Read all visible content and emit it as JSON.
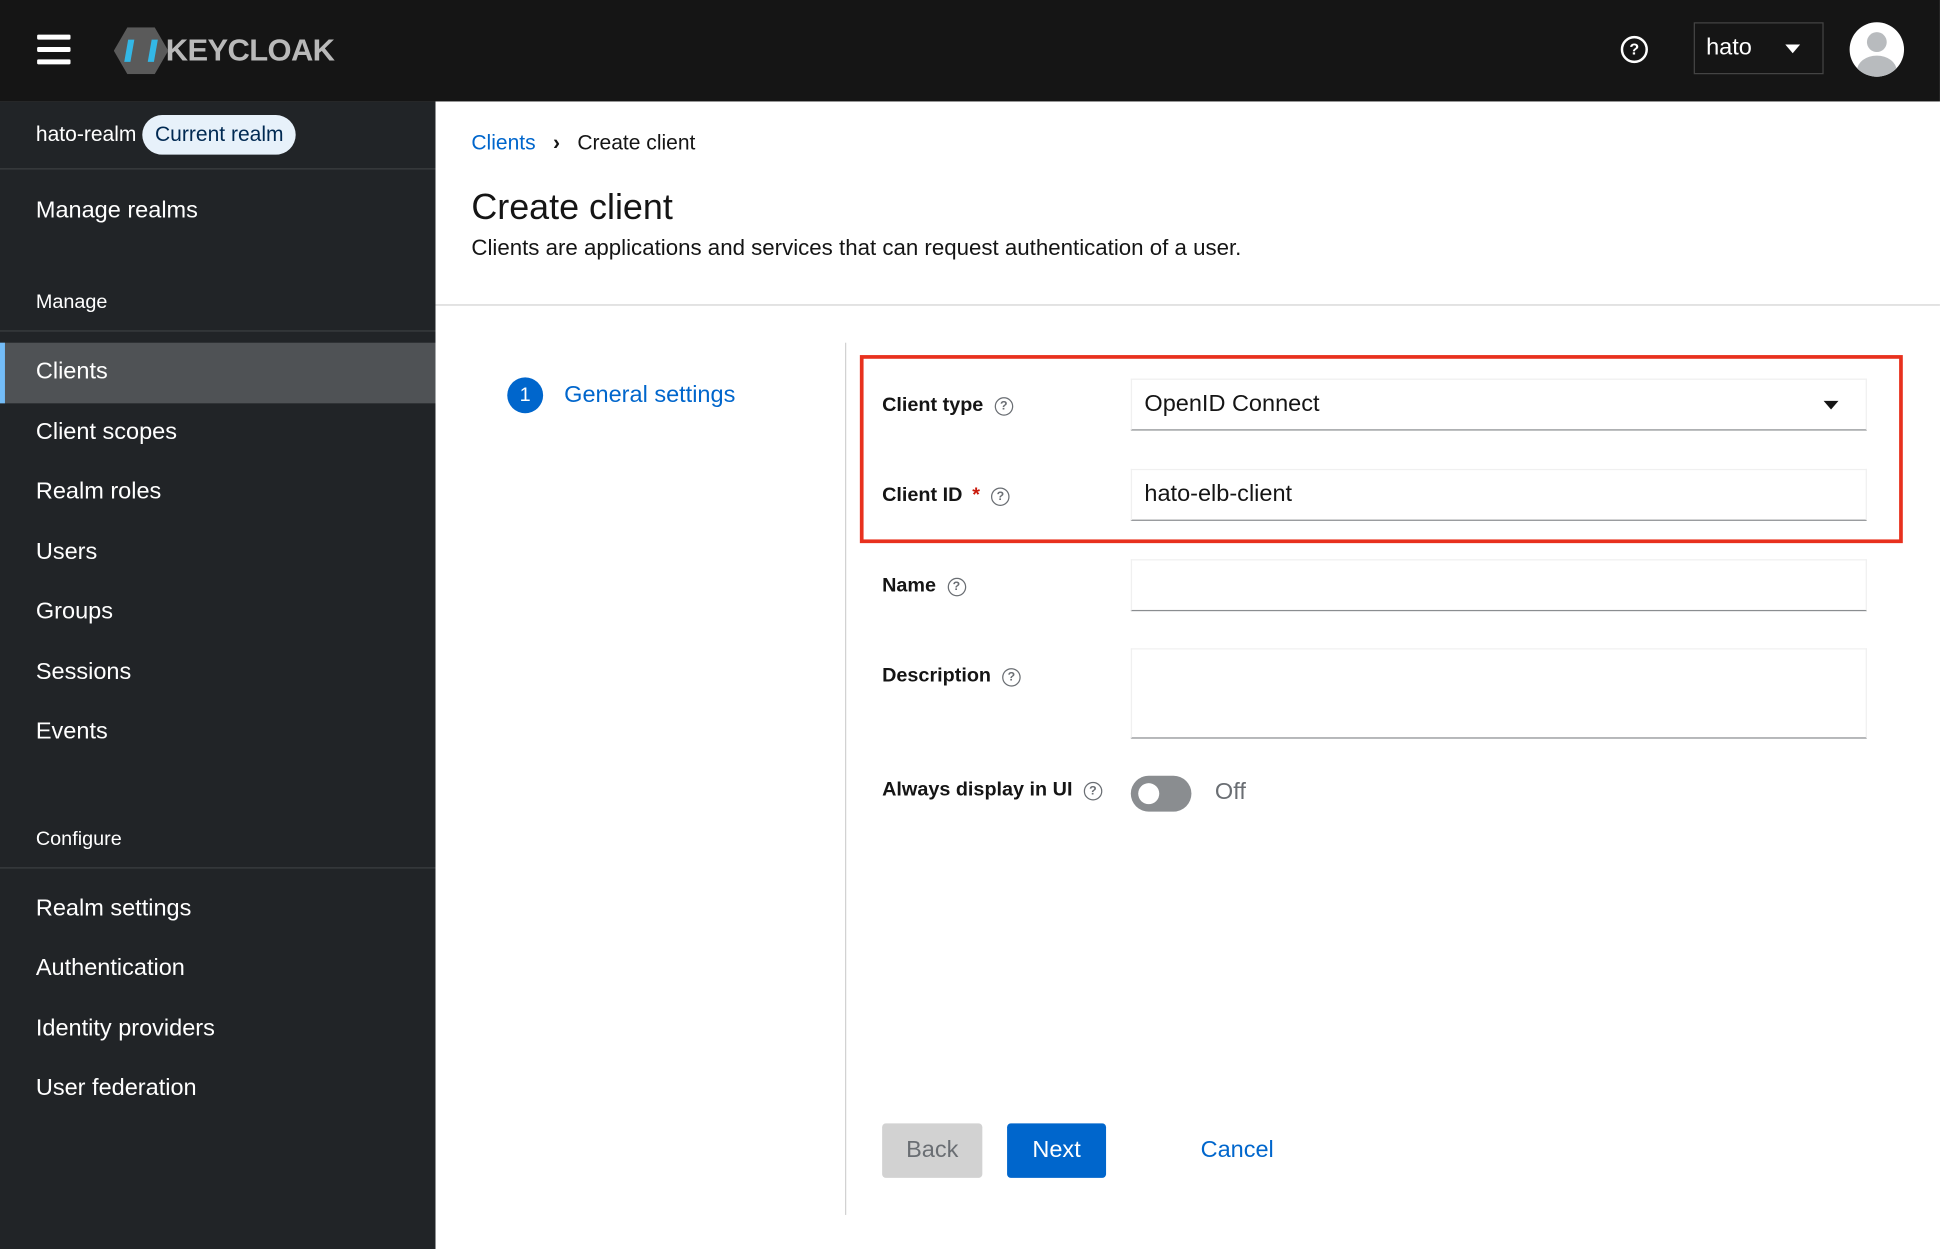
{
  "header": {
    "logo": "KEYCLOAK",
    "user": "hato"
  },
  "sidebar": {
    "realm": "hato-realm",
    "realm_badge": "Current realm",
    "manage_realms": "Manage realms",
    "manage_title": "Manage",
    "manage_items": [
      "Clients",
      "Client scopes",
      "Realm roles",
      "Users",
      "Groups",
      "Sessions",
      "Events"
    ],
    "configure_title": "Configure",
    "configure_items": [
      "Realm settings",
      "Authentication",
      "Identity providers",
      "User federation"
    ]
  },
  "main": {
    "breadcrumb": [
      "Clients",
      "Create client"
    ],
    "title": "Create client",
    "subtitle": "Clients are applications and services that can request authentication of a user.",
    "step": {
      "number": "1",
      "label": "General settings"
    },
    "form": {
      "client_type_label": "Client type",
      "client_type_value": "OpenID Connect",
      "client_id_label": "Client ID",
      "required": "*",
      "client_id_value": "hato-elb-client",
      "name_label": "Name",
      "name_value": "",
      "description_label": "Description",
      "description_value": "",
      "always_display_label": "Always display in UI",
      "always_display_state": "Off"
    },
    "buttons": {
      "back": "Back",
      "next": "Next",
      "cancel": "Cancel"
    }
  },
  "colors": {
    "accent": "#0066cc",
    "highlight": "#e8311e"
  }
}
